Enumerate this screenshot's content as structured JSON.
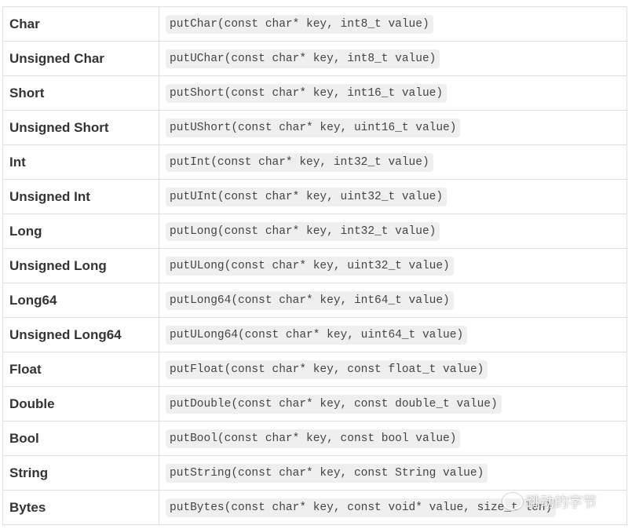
{
  "rows": [
    {
      "type": "Char",
      "method": "putChar(const char* key, int8_t value)"
    },
    {
      "type": "Unsigned Char",
      "method": "putUChar(const char* key, int8_t value)"
    },
    {
      "type": "Short",
      "method": "putShort(const char* key, int16_t value)"
    },
    {
      "type": "Unsigned Short",
      "method": "putUShort(const char* key, uint16_t value)"
    },
    {
      "type": "Int",
      "method": "putInt(const char* key, int32_t value)"
    },
    {
      "type": "Unsigned Int",
      "method": "putUInt(const char* key, uint32_t value)"
    },
    {
      "type": "Long",
      "method": "putLong(const char* key, int32_t value)"
    },
    {
      "type": "Unsigned Long",
      "method": "putULong(const char* key, uint32_t value)"
    },
    {
      "type": "Long64",
      "method": "putLong64(const char* key, int64_t value)"
    },
    {
      "type": "Unsigned Long64",
      "method": "putULong64(const char* key, uint64_t value)"
    },
    {
      "type": "Float",
      "method": "putFloat(const char* key, const float_t value)"
    },
    {
      "type": "Double",
      "method": "putDouble(const char* key, const double_t value)"
    },
    {
      "type": "Bool",
      "method": "putBool(const char* key, const bool value)"
    },
    {
      "type": "String",
      "method": "putString(const char* key, const String value)"
    },
    {
      "type": "Bytes",
      "method": "putBytes(const char* key, const void* value, size_t len)"
    }
  ],
  "watermark": {
    "text": "跳动的字节",
    "icon": "wechat-icon"
  }
}
